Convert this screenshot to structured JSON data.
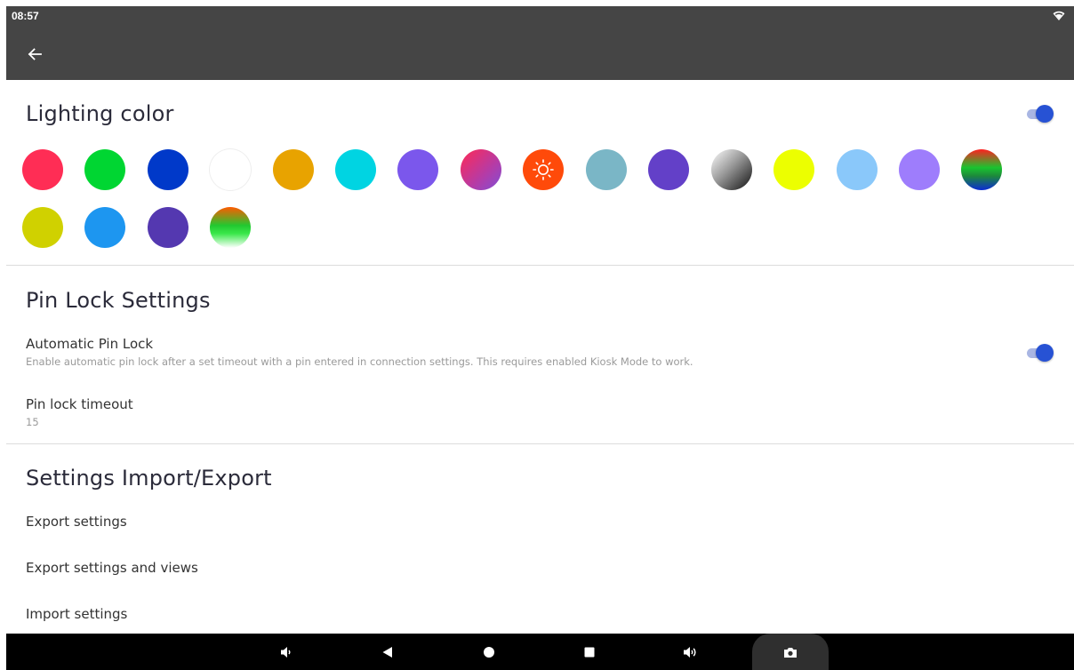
{
  "status_bar": {
    "time": "08:57"
  },
  "lighting": {
    "title": "Lighting color",
    "toggle_on": true,
    "swatches": [
      {
        "name": "red",
        "color": "#ff2d55"
      },
      {
        "name": "green",
        "color": "#00d632"
      },
      {
        "name": "blue",
        "color": "#0039c9"
      },
      {
        "name": "white",
        "color": "#ffffff"
      },
      {
        "name": "amber",
        "color": "#e8a300"
      },
      {
        "name": "cyan",
        "color": "#00d4e2"
      },
      {
        "name": "violet",
        "color": "#7b57ec"
      },
      {
        "name": "pink-purple-gradient",
        "color": "#d02a6e"
      },
      {
        "name": "sun-auto",
        "color": "#ff4a0a"
      },
      {
        "name": "steel-blue",
        "color": "#7ab6c6"
      },
      {
        "name": "deep-purple",
        "color": "#6340c8"
      },
      {
        "name": "gray-gradient",
        "color": "#888888"
      },
      {
        "name": "yellow",
        "color": "#ecff00"
      },
      {
        "name": "light-blue",
        "color": "#8ac8fa"
      },
      {
        "name": "lavender",
        "color": "#9e7dfc"
      },
      {
        "name": "red-green-blue-gradient",
        "color": "#17a32d"
      },
      {
        "name": "olive-yellow",
        "color": "#d0d100"
      },
      {
        "name": "sky-blue",
        "color": "#1d96f0"
      },
      {
        "name": "indigo",
        "color": "#5438b0"
      },
      {
        "name": "orange-green-white-gradient",
        "color": "#2bd438"
      }
    ]
  },
  "pin_lock": {
    "title": "Pin Lock Settings",
    "auto_title": "Automatic Pin Lock",
    "auto_summary": "Enable automatic pin lock after a set timeout with a pin entered in connection settings. This requires enabled Kiosk Mode to work.",
    "auto_toggle_on": true,
    "timeout_title": "Pin lock timeout",
    "timeout_value": "15"
  },
  "import_export": {
    "title": "Settings Import/Export",
    "items": [
      "Export settings",
      "Export settings and views",
      "Import settings"
    ]
  },
  "icons": {
    "back": "arrow-left-icon",
    "wifi": "wifi-icon",
    "sun": "sun-icon",
    "nav": [
      "volume-down-icon",
      "back-triangle-icon",
      "home-circle-icon",
      "recents-square-icon",
      "volume-up-icon",
      "camera-icon"
    ]
  }
}
